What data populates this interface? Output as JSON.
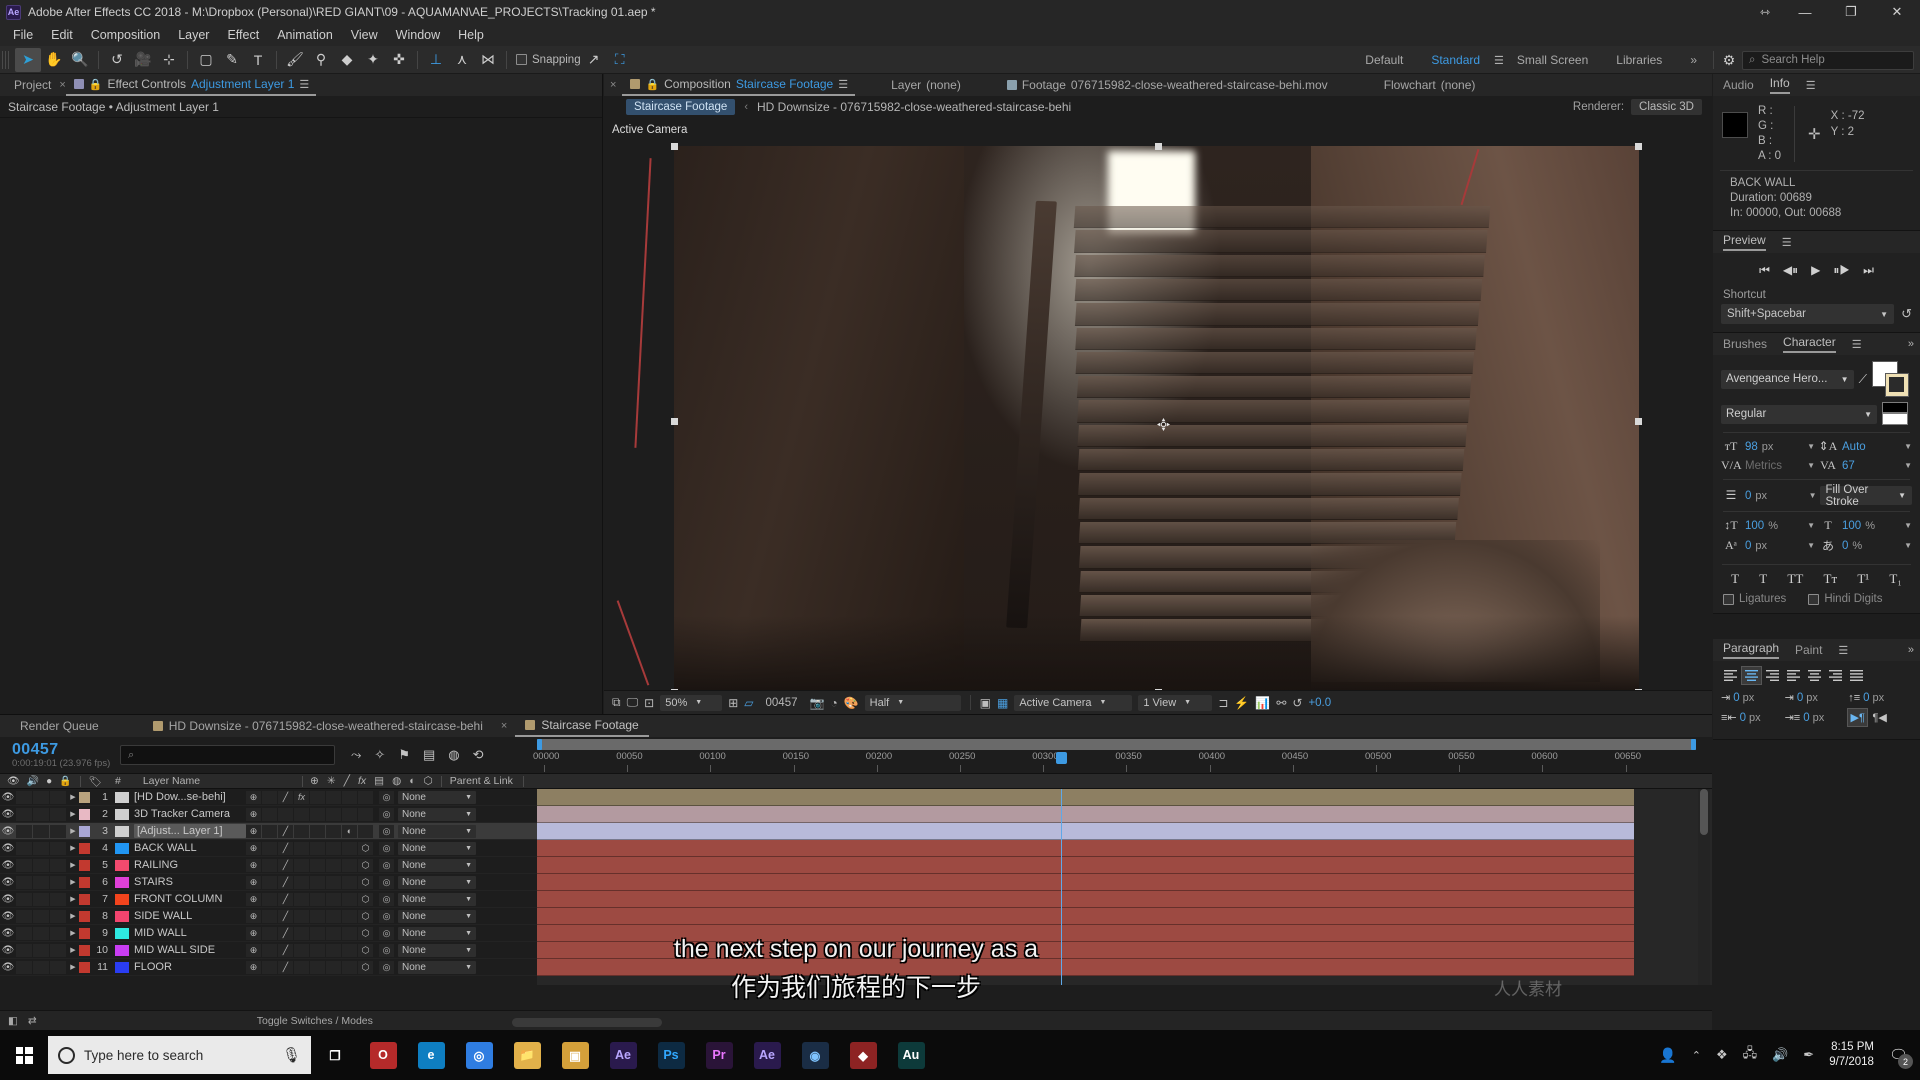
{
  "window": {
    "title": "Adobe After Effects CC 2018 - M:\\Dropbox (Personal)\\RED GIANT\\09 - AQUAMAN\\AE_PROJECTS\\Tracking 01.aep *",
    "logo": "Ae",
    "buttons": {
      "arrows": "⇿",
      "minimize": "—",
      "maximize": "❐",
      "close": "✕"
    }
  },
  "menu": {
    "items": [
      "File",
      "Edit",
      "Composition",
      "Layer",
      "Effect",
      "Animation",
      "View",
      "Window",
      "Help"
    ]
  },
  "toolbar": {
    "tools": [
      {
        "name": "selection-tool",
        "glyph": "➤",
        "active": true
      },
      {
        "name": "hand-tool",
        "glyph": "✋",
        "active": false
      },
      {
        "name": "zoom-tool",
        "glyph": "🔍",
        "active": false
      },
      {
        "name": "rotation-tool",
        "glyph": "↺",
        "active": false
      },
      {
        "name": "camera-tool",
        "glyph": "🎥",
        "active": false
      },
      {
        "name": "pan-behind-tool",
        "glyph": "⊹",
        "active": false
      },
      {
        "name": "shape-tool",
        "glyph": "▢",
        "active": false
      },
      {
        "name": "pen-tool",
        "glyph": "✎",
        "active": false
      },
      {
        "name": "type-tool",
        "glyph": "T",
        "active": false
      },
      {
        "name": "brush-tool",
        "glyph": "🖌",
        "active": false
      },
      {
        "name": "clone-stamp-tool",
        "glyph": "⚲",
        "active": false
      },
      {
        "name": "eraser-tool",
        "glyph": "◆",
        "active": false
      },
      {
        "name": "roto-brush-tool",
        "glyph": "✦",
        "active": false
      },
      {
        "name": "puppet-pin-tool",
        "glyph": "✜",
        "active": false
      }
    ],
    "axis_tools": [
      {
        "name": "local-axis-mode",
        "glyph": "⊥",
        "active": true
      },
      {
        "name": "world-axis-mode",
        "glyph": "⋏",
        "active": false
      },
      {
        "name": "view-axis-mode",
        "glyph": "⋈",
        "active": false
      }
    ],
    "snapping_label": "Snapping"
  },
  "workspace": {
    "items": [
      {
        "label": "Default",
        "selected": false
      },
      {
        "label": "Standard",
        "selected": true
      },
      {
        "label": "Small Screen",
        "selected": false
      },
      {
        "label": "Libraries",
        "selected": false
      }
    ],
    "overflow": "»",
    "search_placeholder": "Search Help"
  },
  "left_panel": {
    "tabs": [
      {
        "label": "Project",
        "active": false,
        "closable": true
      },
      {
        "label": "Effect Controls",
        "active": true,
        "value": "Adjustment Layer 1"
      }
    ],
    "subtitle": "Staircase Footage • Adjustment Layer 1"
  },
  "composition": {
    "tabs": [
      {
        "label": "Composition",
        "value": "Staircase Footage",
        "active": true
      },
      {
        "label": "Layer",
        "value": "(none)",
        "active": false
      },
      {
        "label": "Footage",
        "value": "076715982-close-weathered-staircase-behi.mov",
        "active": false
      },
      {
        "label": "Flowchart",
        "value": "(none)",
        "active": false
      }
    ],
    "breadcrumb_chip": "Staircase Footage",
    "breadcrumb_rest": "HD Downsize - 076715982-close-weathered-staircase-behi",
    "renderer_label": "Renderer:",
    "renderer_value": "Classic 3D",
    "active_camera_label": "Active Camera",
    "footer": {
      "magnification": "50%",
      "timecode": "00457",
      "resolution": "Half",
      "view_camera": "Active Camera",
      "view_layout": "1 View",
      "exposure": "+0.0"
    }
  },
  "info_panel": {
    "tabs": [
      {
        "label": "Audio",
        "active": false
      },
      {
        "label": "Info",
        "active": true
      }
    ],
    "channels": [
      {
        "key": "R :",
        "value": ""
      },
      {
        "key": "G :",
        "value": ""
      },
      {
        "key": "B :",
        "value": ""
      },
      {
        "key": "A :",
        "value": "0"
      }
    ],
    "x_label": "X :",
    "x_value": "-72",
    "y_label": "Y :",
    "y_value": "2",
    "layer_name": "BACK WALL",
    "duration": "Duration: 00689",
    "in_out": "In: 00000, Out: 00688"
  },
  "preview_panel": {
    "title": "Preview",
    "transport": [
      "⏮",
      "◀⏸",
      "▶",
      "⏸▶",
      "⏭"
    ],
    "shortcut_label": "Shortcut",
    "shortcut_value": "Shift+Spacebar"
  },
  "character_panel": {
    "tabs": [
      {
        "label": "Brushes",
        "active": false
      },
      {
        "label": "Character",
        "active": true
      }
    ],
    "font_family": "Avengeance Hero...",
    "font_style": "Regular",
    "font_size": "98",
    "font_size_unit": "px",
    "leading": "Auto",
    "kerning": "Metrics",
    "tracking": "67",
    "stroke_width": "0",
    "stroke_width_unit": "px",
    "fill_stroke_order": "Fill Over Stroke",
    "vertical_scale": "100",
    "vertical_scale_unit": "%",
    "horizontal_scale": "100",
    "horizontal_scale_unit": "%",
    "baseline_shift": "0",
    "baseline_shift_unit": "px",
    "tsume": "0",
    "tsume_unit": "%",
    "style_buttons": [
      "T",
      "T",
      "TT",
      "Tᴛ",
      "T¹",
      "T₁"
    ],
    "ligatures_label": "Ligatures",
    "hindi_digits_label": "Hindi Digits"
  },
  "paragraph_panel": {
    "tabs": [
      {
        "label": "Paragraph",
        "active": true
      },
      {
        "label": "Paint",
        "active": false
      }
    ],
    "overflow": "»",
    "indents": [
      "0",
      "0",
      "0",
      "0",
      "0"
    ],
    "indent_unit": "px"
  },
  "timeline": {
    "tabs": [
      {
        "label": "Render Queue",
        "active": false,
        "closable": false
      },
      {
        "label": "HD Downsize - 076715982-close-weathered-staircase-behi",
        "active": false,
        "closable": true
      },
      {
        "label": "Staircase Footage",
        "active": true,
        "closable": false
      }
    ],
    "current_frame": "00457",
    "current_timecode": "0:00:19:01 (23.976 fps)",
    "search_placeholder": "",
    "columns": [
      "#",
      "Layer Name",
      "Parent & Link"
    ],
    "ruler_ticks": [
      "00000",
      "00050",
      "00100",
      "00150",
      "00200",
      "00250",
      "00300",
      "00350",
      "00400",
      "00450",
      "00500",
      "00550",
      "00600",
      "00650"
    ],
    "footer_label": "Toggle Switches / Modes",
    "layers": [
      {
        "num": "1",
        "name": "[HD Dow...se-behi]",
        "label_color": "#b9a37e",
        "bar_color": "#8d7f62",
        "type": "footage",
        "selected": false,
        "parent": "None",
        "has_fx": true,
        "has_3d": false,
        "has_motionblur": false,
        "has_transform": true,
        "has_adjust": false
      },
      {
        "num": "2",
        "name": "3D Tracker Camera",
        "label_color": "#e8b9c4",
        "bar_color": "#b39aa0",
        "type": "camera",
        "selected": false,
        "parent": "None",
        "has_fx": false,
        "has_3d": false,
        "has_motionblur": false,
        "has_transform": false,
        "has_adjust": false
      },
      {
        "num": "3",
        "name": "[Adjust... Layer 1]",
        "label_color": "#a9a8d6",
        "bar_color": "#b8bada",
        "type": "solid",
        "selected": true,
        "parent": "None",
        "has_fx": false,
        "has_3d": false,
        "has_motionblur": false,
        "has_transform": true,
        "has_adjust": true
      },
      {
        "num": "4",
        "name": "BACK WALL",
        "label_color": "#c2392f",
        "bar_color": "#9d4a42",
        "type": "solid-blue",
        "solid_color": "#2196f3",
        "parent": "None",
        "selected": false,
        "has_fx": false,
        "has_3d": true,
        "has_motionblur": false,
        "has_transform": true,
        "has_adjust": false
      },
      {
        "num": "5",
        "name": "RAILING",
        "label_color": "#c2392f",
        "bar_color": "#9d4a42",
        "type": "solid-pink",
        "solid_color": "#f24a6e",
        "parent": "None",
        "selected": false,
        "has_fx": false,
        "has_3d": true,
        "has_motionblur": false,
        "has_transform": true,
        "has_adjust": false
      },
      {
        "num": "6",
        "name": "STAIRS",
        "label_color": "#c2392f",
        "bar_color": "#9d4a42",
        "type": "solid-magenta",
        "solid_color": "#e040d8",
        "parent": "None",
        "selected": false,
        "has_fx": false,
        "has_3d": true,
        "has_motionblur": false,
        "has_transform": true,
        "has_adjust": false
      },
      {
        "num": "7",
        "name": "FRONT COLUMN",
        "label_color": "#c2392f",
        "bar_color": "#9d4a42",
        "type": "solid-orange",
        "solid_color": "#f2441d",
        "parent": "None",
        "selected": false,
        "has_fx": false,
        "has_3d": true,
        "has_motionblur": false,
        "has_transform": true,
        "has_adjust": false
      },
      {
        "num": "8",
        "name": "SIDE WALL",
        "label_color": "#c2392f",
        "bar_color": "#9d4a42",
        "type": "solid-rose",
        "solid_color": "#f2446e",
        "parent": "None",
        "selected": false,
        "has_fx": false,
        "has_3d": true,
        "has_motionblur": false,
        "has_transform": true,
        "has_adjust": false
      },
      {
        "num": "9",
        "name": "MID WALL",
        "label_color": "#c2392f",
        "bar_color": "#9d4a42",
        "type": "solid-cyan",
        "solid_color": "#2ee8e0",
        "parent": "None",
        "selected": false,
        "has_fx": false,
        "has_3d": true,
        "has_motionblur": false,
        "has_transform": true,
        "has_adjust": false
      },
      {
        "num": "10",
        "name": "MID WALL SIDE",
        "label_color": "#c2392f",
        "bar_color": "#9d4a42",
        "type": "solid-purple",
        "solid_color": "#c93df2",
        "parent": "None",
        "selected": false,
        "has_fx": false,
        "has_3d": true,
        "has_motionblur": false,
        "has_transform": true,
        "has_adjust": false
      },
      {
        "num": "11",
        "name": "FLOOR",
        "label_color": "#c2392f",
        "bar_color": "#9d4a42",
        "type": "solid-indigo",
        "solid_color": "#2a3df2",
        "parent": "None",
        "selected": false,
        "has_fx": false,
        "has_3d": true,
        "has_motionblur": false,
        "has_transform": true,
        "has_adjust": false
      }
    ]
  },
  "subtitles": {
    "line_en": "the next step on our journey as a",
    "line_zh": "作为我们旅程的下一步",
    "watermark": "人人素材"
  },
  "taskbar": {
    "search_placeholder": "Type here to search",
    "apps": [
      {
        "name": "taskview",
        "glyph": "❐",
        "color": "transparent"
      },
      {
        "name": "opera",
        "glyph": "O",
        "color": "#b52a2a"
      },
      {
        "name": "edge",
        "glyph": "e",
        "color": "#0e7ec1"
      },
      {
        "name": "chrome",
        "glyph": "◎",
        "color": "#2f7de1"
      },
      {
        "name": "explorer",
        "glyph": "📁",
        "color": "#e2b14a"
      },
      {
        "name": "store",
        "glyph": "▣",
        "color": "#d4a03a"
      },
      {
        "name": "after-effects",
        "glyph": "Ae",
        "color": "#2a1a4d"
      },
      {
        "name": "photoshop",
        "glyph": "Ps",
        "color": "#0d2a42"
      },
      {
        "name": "premiere",
        "glyph": "Pr",
        "color": "#2a1438"
      },
      {
        "name": "after-effects-2",
        "glyph": "Ae",
        "color": "#2a1a4d"
      },
      {
        "name": "media-encoder",
        "glyph": "◉",
        "color": "#1a2d45"
      },
      {
        "name": "red-giant",
        "glyph": "◆",
        "color": "#8d2323"
      },
      {
        "name": "audition",
        "glyph": "Au",
        "color": "#0d3a3a"
      }
    ],
    "time": "8:15 PM",
    "date": "9/7/2018",
    "notification_count": "2"
  },
  "colors": {
    "accent_blue": "#3d9ae2",
    "panel_bg": "#1d1d1d",
    "header_bg": "#262626",
    "selection": "#3b3b3b"
  }
}
